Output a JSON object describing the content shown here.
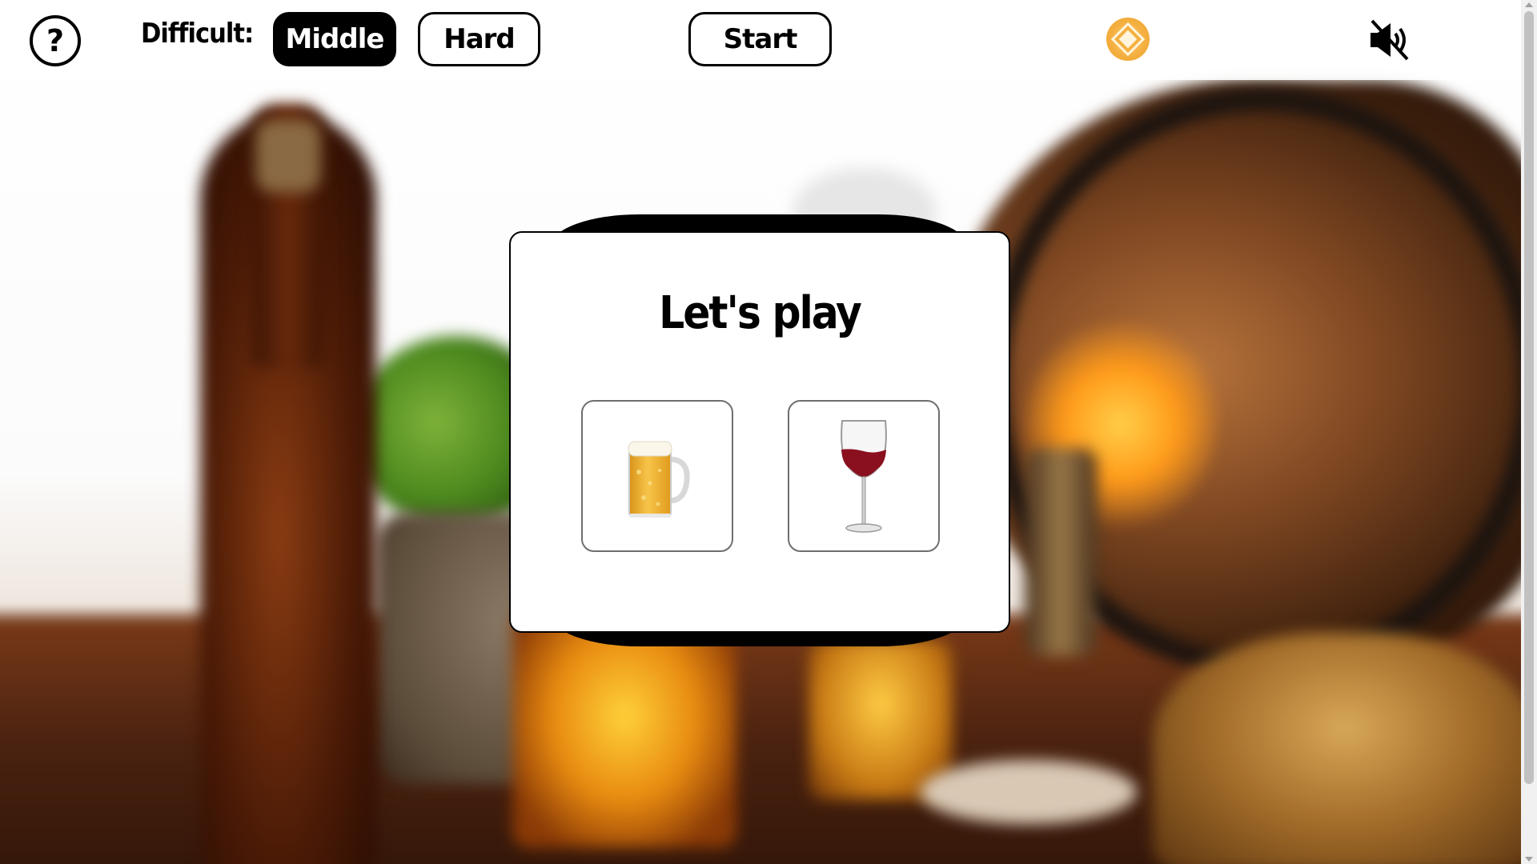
{
  "topbar": {
    "help_glyph": "?",
    "help_icon": "question-circle-icon",
    "difficulty_label": "Difficult:",
    "difficulty_options": [
      {
        "label": "Middle",
        "selected": true
      },
      {
        "label": "Hard",
        "selected": false
      }
    ],
    "start_label": "Start",
    "coin_icon": "coin-icon",
    "sound_icon": "speaker-muted-icon"
  },
  "modal": {
    "title": "Let's play",
    "choices": [
      {
        "name": "beer",
        "icon": "beer-mug-icon"
      },
      {
        "name": "wine",
        "icon": "wine-glass-icon"
      }
    ]
  },
  "colors": {
    "button_active_bg": "#000000",
    "button_active_text": "#ffffff",
    "coin": "#f4b040",
    "beer": "#f0b429",
    "wine": "#8a1020"
  }
}
